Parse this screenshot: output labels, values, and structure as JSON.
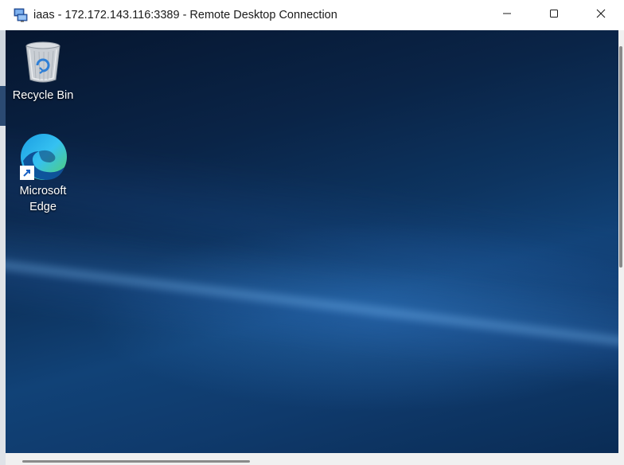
{
  "window": {
    "title": "iaas - 172.172.143.116:3389 - Remote Desktop Connection",
    "app_icon": "remote-desktop-icon",
    "controls": {
      "minimize_icon": "minimize-icon",
      "maximize_icon": "maximize-icon",
      "close_icon": "close-icon"
    }
  },
  "desktop": {
    "icons": [
      {
        "label": "Recycle Bin",
        "icon": "recycle-bin-icon"
      },
      {
        "label_line1": "Microsoft",
        "label_line2": "Edge",
        "icon": "edge-icon",
        "shortcut": true
      }
    ],
    "wallpaper_colors": {
      "dark": "#06162f",
      "mid": "#0d3460",
      "highlight": "#6eafef"
    }
  },
  "scrollbars": {
    "vertical": true,
    "horizontal": true
  }
}
